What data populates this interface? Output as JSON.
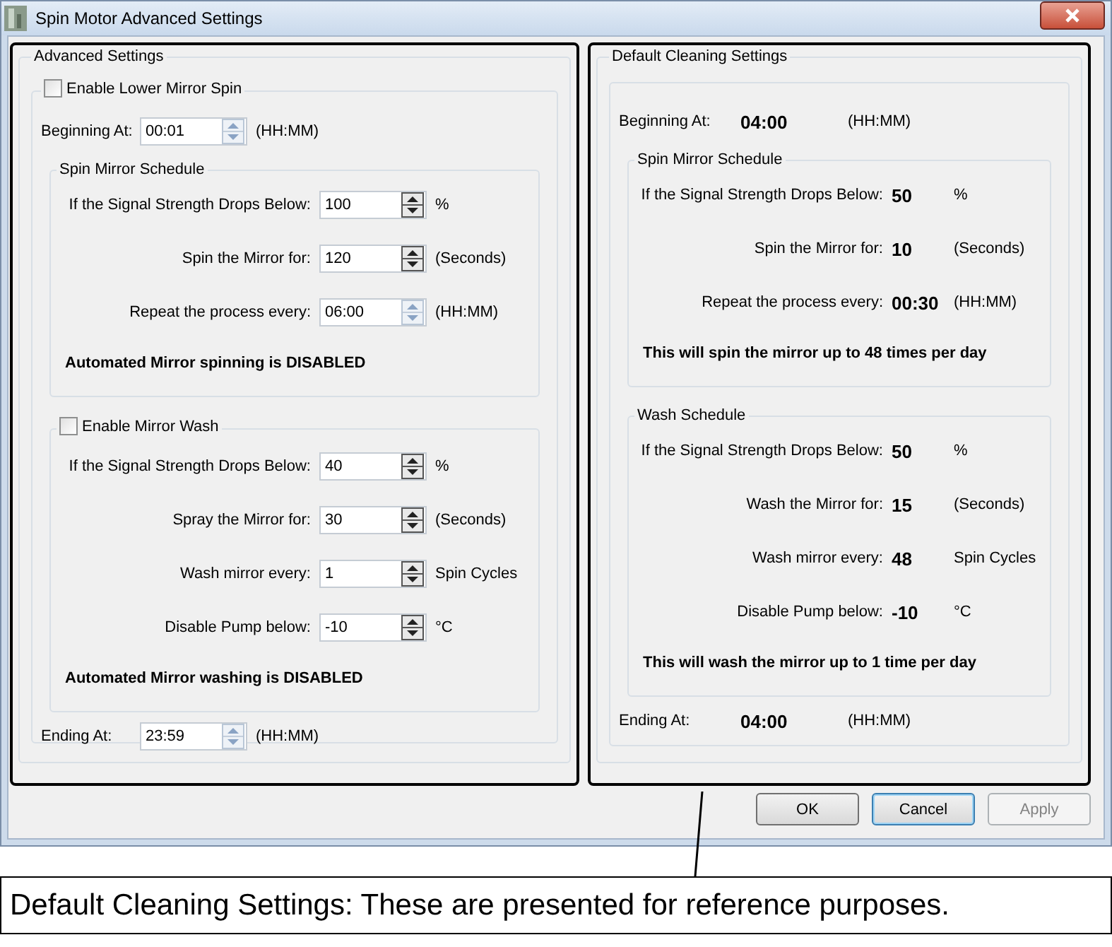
{
  "window": {
    "title": "Spin Motor Advanced Settings"
  },
  "advanced": {
    "title": "Advanced Settings",
    "spin_enable": {
      "label": "Enable Lower Mirror Spin",
      "checked": false
    },
    "beginning": {
      "label": "Beginning At:",
      "value": "00:01",
      "spinner_enabled": false,
      "unit": "(HH:MM)"
    },
    "spin_schedule": {
      "title": "Spin Mirror Schedule",
      "rows": [
        {
          "label": "If the Signal Strength Drops Below:",
          "value": "100",
          "spinner_enabled": true,
          "unit": "%"
        },
        {
          "label": "Spin the Mirror for:",
          "value": "120",
          "spinner_enabled": true,
          "unit": "(Seconds)"
        },
        {
          "label": "Repeat the process every:",
          "value": "06:00",
          "spinner_enabled": false,
          "unit": "(HH:MM)"
        }
      ],
      "status": "Automated Mirror spinning is DISABLED"
    },
    "wash": {
      "enable": {
        "label": "Enable Mirror Wash",
        "checked": false
      },
      "rows": [
        {
          "label": "If the Signal Strength Drops Below:",
          "value": "40",
          "spinner_enabled": true,
          "unit": "%"
        },
        {
          "label": "Spray the Mirror for:",
          "value": "30",
          "spinner_enabled": true,
          "unit": "(Seconds)"
        },
        {
          "label": "Wash mirror every:",
          "value": "1",
          "spinner_enabled": true,
          "unit": "Spin Cycles"
        },
        {
          "label": "Disable Pump below:",
          "value": "-10",
          "spinner_enabled": true,
          "unit": "°C"
        }
      ],
      "status": "Automated Mirror washing is DISABLED"
    },
    "ending": {
      "label": "Ending  At:",
      "value": "23:59",
      "spinner_enabled": false,
      "unit": "(HH:MM)"
    }
  },
  "defaults": {
    "title": "Default Cleaning Settings",
    "beginning": {
      "label": "Beginning At:",
      "value": "04:00",
      "unit": "(HH:MM)"
    },
    "spin_schedule": {
      "title": "Spin Mirror Schedule",
      "rows": [
        {
          "label": "If the Signal Strength Drops Below:",
          "value": "50",
          "unit": "%"
        },
        {
          "label": "Spin the Mirror for:",
          "value": "10",
          "unit": "(Seconds)"
        },
        {
          "label": "Repeat the process every:",
          "value": "00:30",
          "unit": "(HH:MM)"
        }
      ],
      "status": "This will spin the mirror up to 48 times per day"
    },
    "wash_schedule": {
      "title": "Wash Schedule",
      "rows": [
        {
          "label": "If the Signal Strength Drops Below:",
          "value": "50",
          "unit": "%"
        },
        {
          "label": "Wash the Mirror for:",
          "value": "15",
          "unit": "(Seconds)"
        },
        {
          "label": "Wash mirror every:",
          "value": "48",
          "unit": "Spin Cycles"
        },
        {
          "label": "Disable Pump below:",
          "value": "-10",
          "unit": "°C"
        }
      ],
      "status": "This will wash the mirror up to 1 time per day"
    },
    "ending": {
      "label": "Ending  At:",
      "value": "04:00",
      "unit": "(HH:MM)"
    }
  },
  "buttons": [
    {
      "label": "OK",
      "focused": false,
      "disabled": false
    },
    {
      "label": "Cancel",
      "focused": true,
      "disabled": false
    },
    {
      "label": "Apply",
      "focused": false,
      "disabled": true
    }
  ],
  "callout": {
    "text": "Default Cleaning Settings: These are presented for reference purposes."
  }
}
